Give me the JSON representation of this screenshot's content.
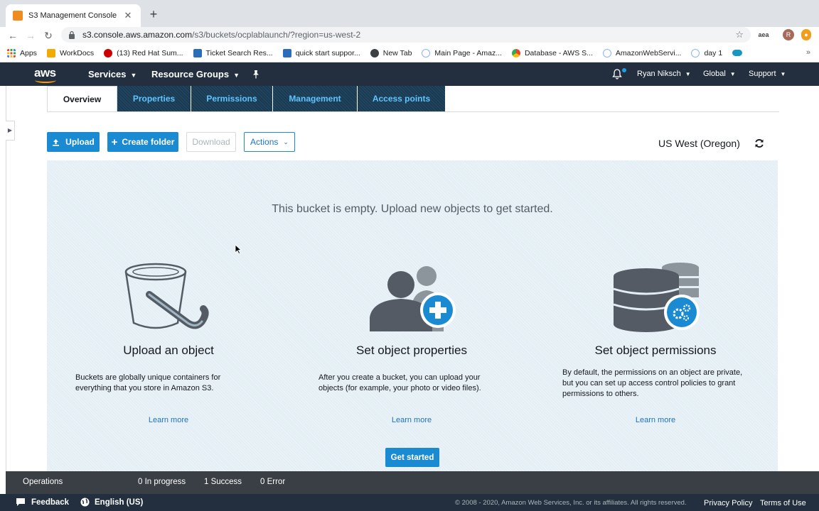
{
  "browser": {
    "tab_title": "S3 Management Console",
    "url_host": "s3.console.aws.amazon.com",
    "url_path": "/s3/buckets/ocplablaunch/?region=us-west-2",
    "extension_label": "aea",
    "profile_initial": "R"
  },
  "bookmarks": [
    {
      "label": "Apps",
      "color": "#e8453c"
    },
    {
      "label": "WorkDocs",
      "color": "#f2a900"
    },
    {
      "label": "(13) Red Hat Sum...",
      "color": "#cc0000"
    },
    {
      "label": "Ticket Search Res...",
      "color": "#2a6ebb"
    },
    {
      "label": "quick start suppor...",
      "color": "#2a6ebb"
    },
    {
      "label": "New Tab",
      "color": "#3c4043"
    },
    {
      "label": "Main Page - Amaz...",
      "color": "#8ab4f8"
    },
    {
      "label": "Database - AWS S...",
      "color": "#34a853"
    },
    {
      "label": "AmazonWebServi...",
      "color": "#8ab4f8"
    },
    {
      "label": "day 1",
      "color": "#8ab4f8"
    }
  ],
  "aws_nav": {
    "logo": "aws",
    "services": "Services",
    "resource_groups": "Resource Groups",
    "user": "Ryan Niksch",
    "region_menu": "Global",
    "support": "Support"
  },
  "tabs": [
    {
      "label": "Overview",
      "active": true
    },
    {
      "label": "Properties",
      "active": false
    },
    {
      "label": "Permissions",
      "active": false
    },
    {
      "label": "Management",
      "active": false
    },
    {
      "label": "Access points",
      "active": false
    }
  ],
  "actions": {
    "upload": "Upload",
    "create_folder": "Create folder",
    "download": "Download",
    "actions": "Actions",
    "region": "US West (Oregon)"
  },
  "empty_state": {
    "message": "This bucket is empty. Upload new objects to get started.",
    "cards": [
      {
        "title": "Upload an object",
        "description": "Buckets are globally unique containers for everything that you store in Amazon S3.",
        "link": "Learn more"
      },
      {
        "title": "Set object properties",
        "description": "After you create a bucket, you can upload your objects (for example, your photo or video files).",
        "link": "Learn more"
      },
      {
        "title": "Set object permissions",
        "description": "By default, the permissions on an object are private, but you can set up access control policies to grant permissions to others.",
        "link": "Learn more"
      }
    ],
    "get_started": "Get started"
  },
  "operations": {
    "label": "Operations",
    "in_progress": "0 In progress",
    "success": "1 Success",
    "error": "0 Error"
  },
  "footer": {
    "feedback": "Feedback",
    "language": "English (US)",
    "copyright": "© 2008 - 2020, Amazon Web Services, Inc. or its affiliates. All rights reserved.",
    "privacy": "Privacy Policy",
    "terms": "Terms of Use"
  },
  "colors": {
    "aws_nav_bg": "#232f3e",
    "primary_blue": "#1a8bd3",
    "link_blue": "#1a74c6",
    "aws_orange": "#ff9900",
    "panel_bg": "#e4eef5"
  }
}
